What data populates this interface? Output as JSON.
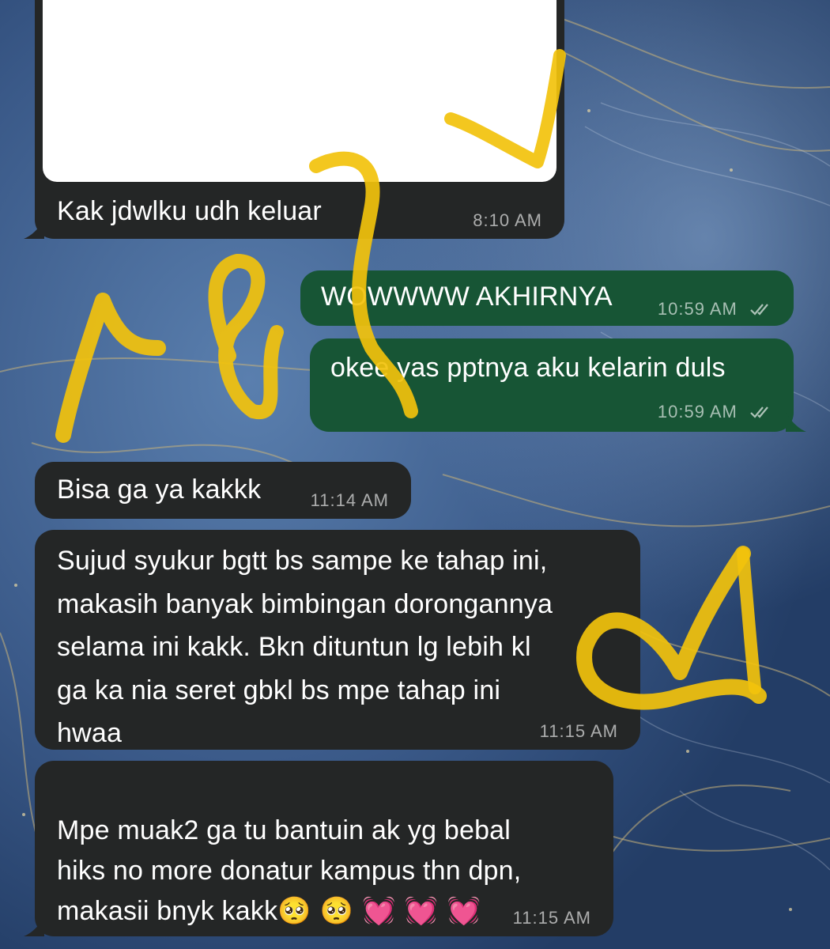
{
  "messages": [
    {
      "id": "m1",
      "direction": "incoming",
      "text": "Kak jdwlku udh keluar",
      "time": "8:10 AM",
      "has_image": true
    },
    {
      "id": "m2",
      "direction": "outgoing",
      "text": "WOWWWW AKHIRNYA",
      "time": "10:59 AM",
      "read": true
    },
    {
      "id": "m3",
      "direction": "outgoing",
      "text": "okee yas pptnya aku kelarin duls",
      "time": "10:59 AM",
      "read": true
    },
    {
      "id": "m4",
      "direction": "incoming",
      "text": "Bisa ga ya kakkk",
      "time": "11:14 AM"
    },
    {
      "id": "m5",
      "direction": "incoming",
      "text": "Sujud syukur bgtt bs sampe ke tahap ini,\nmakasih banyak bimbingan dorongannya\nselama ini kakk. Bkn dituntun lg lebih kl\nga ka nia seret gbkl bs mpe tahap ini\nhwaa",
      "time": "11:15 AM"
    },
    {
      "id": "m6",
      "direction": "incoming",
      "text": "Mpe muak2 ga tu bantuin ak yg bebal\nhiks no more donatur kampus thn dpn,\nmakasii bnyk kakk",
      "emoji": "🥺 🥺 💓 💓 💓",
      "time": "11:15 AM"
    }
  ],
  "icons": {
    "read_receipt": "double-check-icon"
  },
  "colors": {
    "incoming_bubble": "#242626",
    "outgoing_bubble": "#175535",
    "scribble": "#f2c20c"
  }
}
